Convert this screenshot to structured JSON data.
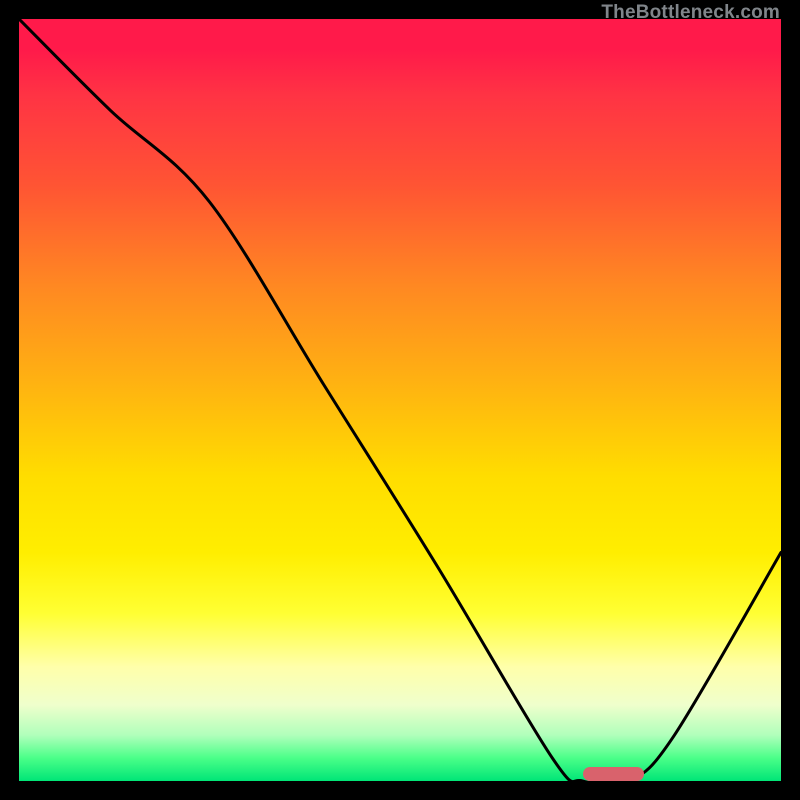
{
  "watermark": "TheBottleneck.com",
  "chart_data": {
    "type": "line",
    "title": "",
    "xlabel": "",
    "ylabel": "",
    "xlim": [
      0,
      100
    ],
    "ylim": [
      0,
      100
    ],
    "grid": false,
    "background": "red-yellow-green-vertical-gradient",
    "series": [
      {
        "name": "bottleneck-curve",
        "x": [
          0,
          12,
          25,
          40,
          55,
          70,
          74,
          80,
          86,
          100
        ],
        "y": [
          100,
          88,
          76,
          52,
          28,
          3,
          0,
          0,
          6,
          30
        ],
        "color": "#000000"
      }
    ],
    "marker": {
      "name": "optimal-range",
      "x_start": 74,
      "x_end": 82,
      "y": 0,
      "color": "#d9626c"
    },
    "colors": {
      "gradient_top": "#ff1a4a",
      "gradient_mid": "#ffee00",
      "gradient_bottom": "#00e577",
      "curve": "#000000",
      "marker": "#d9626c",
      "frame": "#000000"
    }
  }
}
